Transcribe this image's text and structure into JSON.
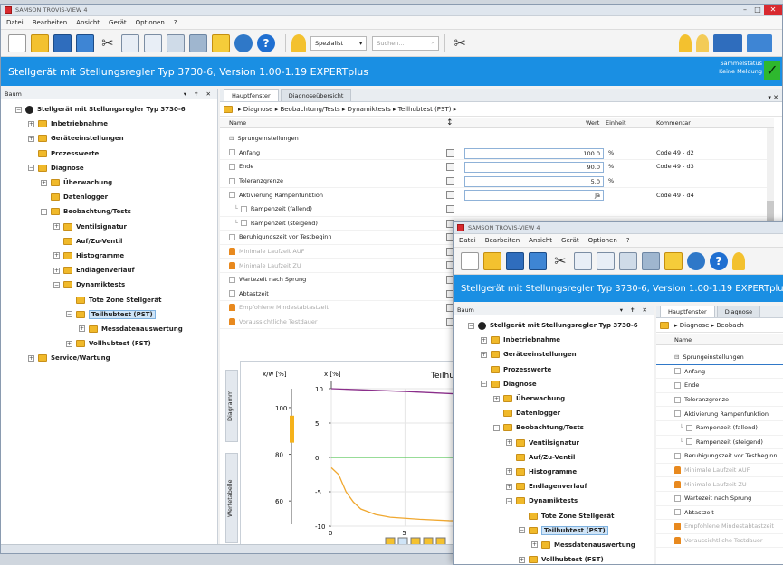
{
  "window_title": "SAMSON TROVIS-VIEW 4",
  "menu": [
    "Datei",
    "Bearbeiten",
    "Ansicht",
    "Gerät",
    "Optionen",
    "?"
  ],
  "toolbar": {
    "dropdown_value": "Spezialist",
    "search_placeholder": "Suchen..."
  },
  "device_title": "Stellgerät mit Stellungsregler Typ 3730-6, Version 1.00-1.19 EXPERTplus",
  "status": {
    "line1": "Sammelstatus",
    "line2": "Keine Meldung",
    "ok_mark": "✓"
  },
  "tree": {
    "pane_title": "Baum",
    "pane_controls": "▾ ✝ ✕",
    "nodes": [
      {
        "label": "Stellgerät mit Stellungsregler Typ 3730-6",
        "level": 0,
        "exp": "−",
        "icon": "root"
      },
      {
        "label": "Inbetriebnahme",
        "level": 1,
        "exp": "+",
        "icon": "folder"
      },
      {
        "label": "Geräteeinstellungen",
        "level": 1,
        "exp": "+",
        "icon": "folder"
      },
      {
        "label": "Prozesswerte",
        "level": 1,
        "exp": "",
        "icon": "folder"
      },
      {
        "label": "Diagnose",
        "level": 1,
        "exp": "−",
        "icon": "folder"
      },
      {
        "label": "Überwachung",
        "level": 2,
        "exp": "+",
        "icon": "folder"
      },
      {
        "label": "Datenlogger",
        "level": 2,
        "exp": "",
        "icon": "folder"
      },
      {
        "label": "Beobachtung/Tests",
        "level": 2,
        "exp": "−",
        "icon": "folder"
      },
      {
        "label": "Ventilsignatur",
        "level": 3,
        "exp": "+",
        "icon": "folder"
      },
      {
        "label": "Auf/Zu-Ventil",
        "level": 3,
        "exp": "",
        "icon": "folder"
      },
      {
        "label": "Histogramme",
        "level": 3,
        "exp": "+",
        "icon": "folder"
      },
      {
        "label": "Endlagenverlauf",
        "level": 3,
        "exp": "+",
        "icon": "folder"
      },
      {
        "label": "Dynamiktests",
        "level": 3,
        "exp": "−",
        "icon": "folder"
      },
      {
        "label": "Tote Zone Stellgerät",
        "level": 4,
        "exp": "",
        "icon": "folder"
      },
      {
        "label": "Teilhubtest (PST)",
        "level": 4,
        "exp": "−",
        "icon": "folder",
        "selected": true
      },
      {
        "label": "Messdatenauswertung",
        "level": 5,
        "exp": "+",
        "icon": "folder"
      },
      {
        "label": "Vollhubtest (FST)",
        "level": 4,
        "exp": "+",
        "icon": "folder"
      },
      {
        "label": "Service/Wartung",
        "level": 1,
        "exp": "+",
        "icon": "folder"
      }
    ]
  },
  "tabs": [
    "Hauptfenster",
    "Diagnoseübersicht"
  ],
  "tabs_back": [
    "Hauptfenster",
    "Diagnose"
  ],
  "breadcrumb": "▸ Diagnose ▸ Beobachtung/Tests ▸ Dynamiktests ▸ Teilhubtest (PST) ▸",
  "breadcrumb_back": "▸ Diagnose ▸ Beobach",
  "grid": {
    "headers": {
      "name": "Name",
      "value": "Wert",
      "unit": "Einheit",
      "comment": "Kommentar"
    },
    "group": "Sprungeinstellungen",
    "rows": [
      {
        "name": "Anfang",
        "value": "100.0",
        "unit": "%",
        "comment": "Code 49 - d2",
        "kind": "chk"
      },
      {
        "name": "Ende",
        "value": "90.0",
        "unit": "%",
        "comment": "Code 49 - d3",
        "kind": "chk"
      },
      {
        "name": "Toleranzgrenze",
        "value": "5.0",
        "unit": "%",
        "comment": "",
        "kind": "chk"
      },
      {
        "name": "Aktivierung Rampenfunktion",
        "value": "Ja",
        "unit": "",
        "comment": "Code 49 - d4",
        "kind": "chk"
      },
      {
        "name": "Rampenzeit (fallend)",
        "value": "",
        "unit": "",
        "comment": "",
        "kind": "sub"
      },
      {
        "name": "Rampenzeit (steigend)",
        "value": "",
        "unit": "",
        "comment": "",
        "kind": "sub"
      },
      {
        "name": "Beruhigungszeit vor Testbeginn",
        "value": "",
        "unit": "",
        "comment": "",
        "kind": "chk"
      },
      {
        "name": "Minimale Laufzeit AUF",
        "value": "",
        "unit": "",
        "comment": "",
        "kind": "lock"
      },
      {
        "name": "Minimale Laufzeit ZU",
        "value": "",
        "unit": "",
        "comment": "",
        "kind": "lock"
      },
      {
        "name": "Wartezeit nach Sprung",
        "value": "",
        "unit": "",
        "comment": "",
        "kind": "chk"
      },
      {
        "name": "Abtastzeit",
        "value": "",
        "unit": "",
        "comment": "",
        "kind": "chk"
      },
      {
        "name": "Empfohlene Mindestabtastzeit",
        "value": "",
        "unit": "",
        "comment": "",
        "kind": "lock"
      },
      {
        "name": "Voraussichtliche Testdauer",
        "value": "",
        "unit": "",
        "comment": "",
        "kind": "lock"
      }
    ]
  },
  "side_tabs": [
    "Diagramm",
    "Wertetabelle"
  ],
  "chart_data": {
    "type": "line",
    "title": "Teilhubt",
    "gauge": {
      "ylabel": "x/w [%]",
      "ticks": [
        100,
        80,
        60
      ],
      "level": 95
    },
    "main": {
      "ylabel": "x [%]",
      "yticks": [
        10,
        5,
        0,
        -5,
        -10
      ],
      "ylim": [
        -10,
        10
      ],
      "xticks": [
        0,
        5,
        10
      ],
      "xlim": [
        0,
        30
      ],
      "series": [
        {
          "color": "#8b2f8b",
          "x": [
            0,
            5,
            10,
            15,
            20,
            25,
            30
          ],
          "y": [
            10,
            9.6,
            9.1,
            8.6,
            8.1,
            7.6,
            7.1
          ]
        },
        {
          "color": "#5ac85a",
          "x": [
            0,
            30
          ],
          "y": [
            0,
            0
          ]
        },
        {
          "color": "#f0a830",
          "x": [
            0,
            0.5,
            1,
            1.5,
            2,
            3,
            4,
            6,
            8,
            12,
            18,
            30
          ],
          "y": [
            -1.5,
            -2.5,
            -5,
            -6.5,
            -7.5,
            -8.3,
            -8.7,
            -9,
            -9.2,
            -9.3,
            -9.4,
            -9.5
          ]
        }
      ]
    }
  },
  "colors": {
    "accent": "#1a8fe3",
    "folder": "#f0b92a",
    "ok": "#2eb82e"
  }
}
